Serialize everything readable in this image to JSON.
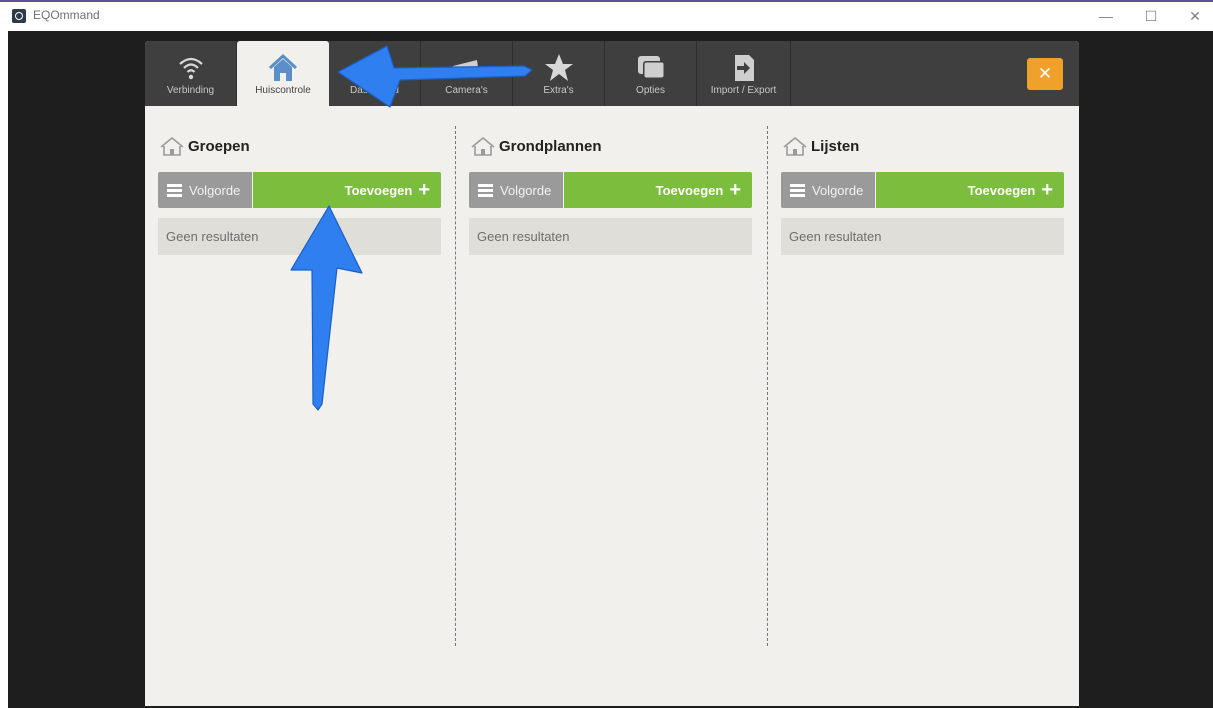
{
  "window": {
    "title": "EQOmmand",
    "controls": [
      "—",
      "☐",
      "✕"
    ]
  },
  "toolbar": {
    "tabs": [
      {
        "label": "Verbinding",
        "icon": "wifi-icon"
      },
      {
        "label": "Huiscontrole",
        "icon": "home-icon",
        "active": true
      },
      {
        "label": "Dashboard",
        "icon": "dashboard-icon"
      },
      {
        "label": "Camera's",
        "icon": "camera-icon"
      },
      {
        "label": "Extra's",
        "icon": "star-icon"
      },
      {
        "label": "Opties",
        "icon": "windows-icon"
      },
      {
        "label": "Import / Export",
        "icon": "import-export-icon"
      }
    ],
    "close_label": "✕"
  },
  "columns": [
    {
      "title": "Groepen",
      "order_label": "Volgorde",
      "add_label": "Toevoegen",
      "empty_text": "Geen resultaten"
    },
    {
      "title": "Grondplannen",
      "order_label": "Volgorde",
      "add_label": "Toevoegen",
      "empty_text": "Geen resultaten"
    },
    {
      "title": "Lijsten",
      "order_label": "Volgorde",
      "add_label": "Toevoegen",
      "empty_text": "Geen resultaten"
    }
  ],
  "colors": {
    "accent_green": "#7bbd3c",
    "close_orange": "#f0a12c",
    "arrow_blue": "#2f7ff0",
    "toolbar": "#3f3f3f"
  }
}
